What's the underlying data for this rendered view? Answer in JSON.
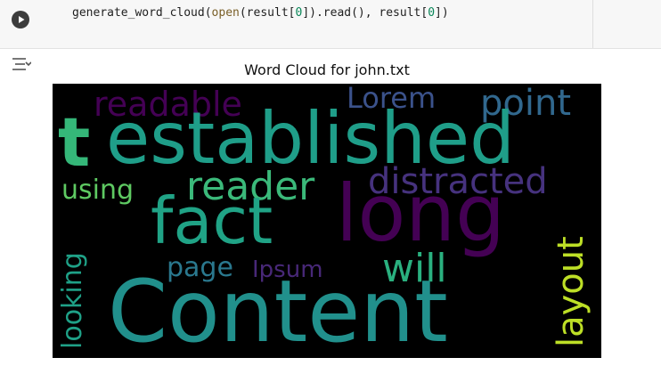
{
  "cell": {
    "code_parts": {
      "fn": "generate_word_cloud(",
      "builtin": "open",
      "rest1": "(result[",
      "idx1": "0",
      "rest2": "]).read(), result[",
      "idx2": "0",
      "rest3": "])"
    }
  },
  "icons": {
    "run": "play-icon",
    "output": "output-toggle-icon"
  },
  "output": {
    "title": "Word Cloud for john.txt"
  },
  "wordcloud": {
    "words": [
      {
        "text": "readable",
        "color": "#440154"
      },
      {
        "text": "Lorem",
        "color": "#3b528b"
      },
      {
        "text": "point",
        "color": "#31688e"
      },
      {
        "text": "established",
        "color": "#1f9e89"
      },
      {
        "text": "t",
        "color": "#35b779"
      },
      {
        "text": "using",
        "color": "#5ec962"
      },
      {
        "text": "reader",
        "color": "#3bb97a"
      },
      {
        "text": "distracted",
        "color": "#46327e"
      },
      {
        "text": "fact",
        "color": "#20a386"
      },
      {
        "text": "long",
        "color": "#440154"
      },
      {
        "text": "looking",
        "color": "#1fa187"
      },
      {
        "text": "page",
        "color": "#2a788e"
      },
      {
        "text": "Ipsum",
        "color": "#482878"
      },
      {
        "text": "will",
        "color": "#2ab07f"
      },
      {
        "text": "layout",
        "color": "#bddf26"
      },
      {
        "text": "Content",
        "color": "#21908c"
      }
    ]
  }
}
